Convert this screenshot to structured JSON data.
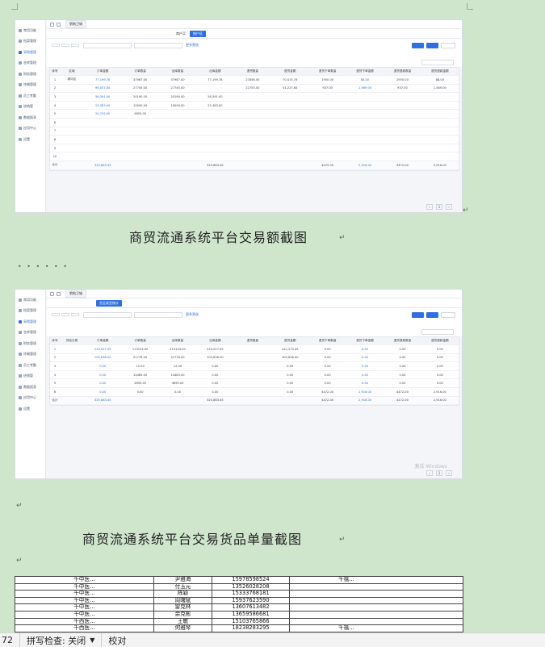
{
  "screenshots": [
    {
      "window_title": "狼狗卫城",
      "sidebar": [
        "常用功能",
        "档案管理",
        "采购管理",
        "仓库管理",
        "财务管理",
        "终端管理",
        "员工考勤",
        "进销管",
        "数据报表",
        "应用中心",
        "设置"
      ],
      "sidebar_active": 2,
      "tabs": [
        "",
        "",
        "",
        "",
        "",
        "",
        "",
        "",
        "商户买",
        "按户区",
        "",
        "",
        "",
        "",
        ""
      ],
      "tab_active": 9,
      "tab_right": "",
      "filter": {
        "seg1": "",
        "seg2": "",
        "seg3": "",
        "date1": "",
        "date2": "",
        "link": "更多筛选"
      },
      "crumb": "",
      "columns": [
        "序号",
        "区域",
        "订单金额",
        "订单数量",
        "出库数量",
        "出库金额",
        "退货数量",
        "退货金额",
        "退货下单数量",
        "退货下单金额",
        "退货退款数量",
        "退货退款金额"
      ],
      "rows": [
        [
          "1",
          "城中区",
          "77,199.78",
          "37987.00",
          "37987.00",
          "77,199.78",
          "27856.00",
          "70,415.78",
          "1950.00",
          "88.00",
          "1950.00",
          "88.00"
        ],
        [
          "2",
          "",
          "98,037.84",
          "27745.00",
          "27745.00",
          "",
          "22753.00",
          "41,227.84",
          "937.00",
          "1,569.00",
          "937.00",
          "1,569.00"
        ],
        [
          "3",
          "",
          "58,391.00",
          "20190.00",
          "20190.00",
          "58,391.00",
          "",
          "",
          "",
          "",
          "",
          ""
        ],
        [
          "4",
          "",
          "25,383.00",
          "15090.00",
          "15090.00",
          "25,383.00",
          "",
          "",
          "",
          "",
          "",
          ""
        ],
        [
          "5",
          "",
          "20,742.00",
          "4853.00",
          "",
          "",
          "",
          "",
          "",
          "",
          "",
          ""
        ],
        [
          "6",
          "",
          "",
          "",
          "",
          "",
          "",
          "",
          "",
          "",
          "",
          ""
        ],
        [
          "7",
          "",
          "",
          "",
          "",
          "",
          "",
          "",
          "",
          "",
          "",
          ""
        ],
        [
          "8",
          "",
          "",
          "",
          "",
          "",
          "",
          "",
          "",
          "",
          "",
          ""
        ],
        [
          "9",
          "",
          "",
          "",
          "",
          "",
          "",
          "",
          "",
          "",
          "",
          ""
        ],
        [
          "10",
          "",
          "",
          "",
          "",
          "",
          "",
          "",
          "",
          "",
          "",
          ""
        ]
      ],
      "total": [
        "合计",
        "",
        "325,863.45",
        "",
        "",
        "325,863.45",
        "",
        "",
        "4472.00",
        "2,916.00",
        "4472.00",
        "2,916.00"
      ],
      "pager": "",
      "watermark": ""
    },
    {
      "window_title": "狼狗卫城",
      "sidebar": [
        "常用功能",
        "档案管理",
        "采购管理",
        "仓库管理",
        "财务管理",
        "终端管理",
        "员工考勤",
        "进销管",
        "数据报表",
        "应用中心",
        "设置"
      ],
      "sidebar_active": 2,
      "tabs": [
        "",
        "",
        "",
        "货品类型统计",
        "",
        "",
        "",
        "",
        "",
        "",
        "",
        "",
        "",
        ""
      ],
      "tab_active": 3,
      "tab_right": "",
      "filter": {
        "seg1": "",
        "seg2": "",
        "seg3": "",
        "date1": "",
        "date2": "",
        "link": "更多筛选"
      },
      "crumb": "",
      "columns": [
        "序号",
        "货品分类",
        "订单金额",
        "订单数量",
        "出库数量",
        "出库金额",
        "退货数量",
        "退货金额",
        "退货下单数量",
        "退货下单金额",
        "退货退款数量",
        "退货退款金额"
      ],
      "rows": [
        [
          "1",
          "",
          "220,027.45",
          "113104.00",
          "113104.00",
          "220,027.45",
          "",
          "212,273.45",
          "0.00",
          "0.00",
          "0.00",
          "0.00"
        ],
        [
          "2",
          "",
          "105,836.00",
          "51778.00",
          "51778.00",
          "105,836.00",
          "",
          "105,836.00",
          "0.00",
          "0.00",
          "0.00",
          "0.00"
        ],
        [
          "3",
          "",
          "0.00",
          "12.00",
          "12.00",
          "0.00",
          "",
          "0.00",
          "0.00",
          "0.00",
          "0.00",
          "0.00"
        ],
        [
          "4",
          "",
          "0.00",
          "14485.00",
          "14485.00",
          "0.00",
          "",
          "0.00",
          "0.00",
          "0.00",
          "0.00",
          "0.00"
        ],
        [
          "5",
          "",
          "0.00",
          "4895.00",
          "4895.00",
          "0.00",
          "",
          "0.00",
          "0.00",
          "0.00",
          "0.00",
          "0.00"
        ],
        [
          "6",
          "",
          "0.00",
          "0.00",
          "0.00",
          "0.00",
          "",
          "0.00",
          "4472.00",
          "2,916.00",
          "4472.00",
          "2,916.00"
        ]
      ],
      "total": [
        "合计",
        "",
        "325,863.45",
        "",
        "",
        "325,863.45",
        "",
        "",
        "4472.00",
        "2,916.00",
        "4472.00",
        "2,916.00"
      ],
      "pager": "",
      "watermark": "激活 Windows"
    }
  ],
  "captions": [
    "商贸流通系统平台交易额截图",
    "商贸流通系统平台交易货品单量截图"
  ],
  "contacts": [
    [
      "千中医…",
      "尹雅海",
      "15978598524",
      "千禧…"
    ],
    [
      "千中医…",
      "付玉元",
      "13526028208",
      ""
    ],
    [
      "千中医…",
      "陈颖",
      "15333768181",
      ""
    ],
    [
      "千中医…",
      "周曙斌",
      "15937623590",
      ""
    ],
    [
      "千中医…",
      "雷克林",
      "13607613482",
      ""
    ],
    [
      "千中医…",
      "余克彬",
      "13659586681",
      ""
    ],
    [
      "千西医…",
      "王敏",
      "15103765866",
      ""
    ],
    [
      "千西医…",
      "何雅琴",
      "18238283295",
      "千禧…"
    ],
    [
      "千西医…",
      "",
      "",
      ""
    ]
  ],
  "status_bar": {
    "page": "72",
    "spell": "拼写检查: 关闭",
    "proof": "校对"
  }
}
